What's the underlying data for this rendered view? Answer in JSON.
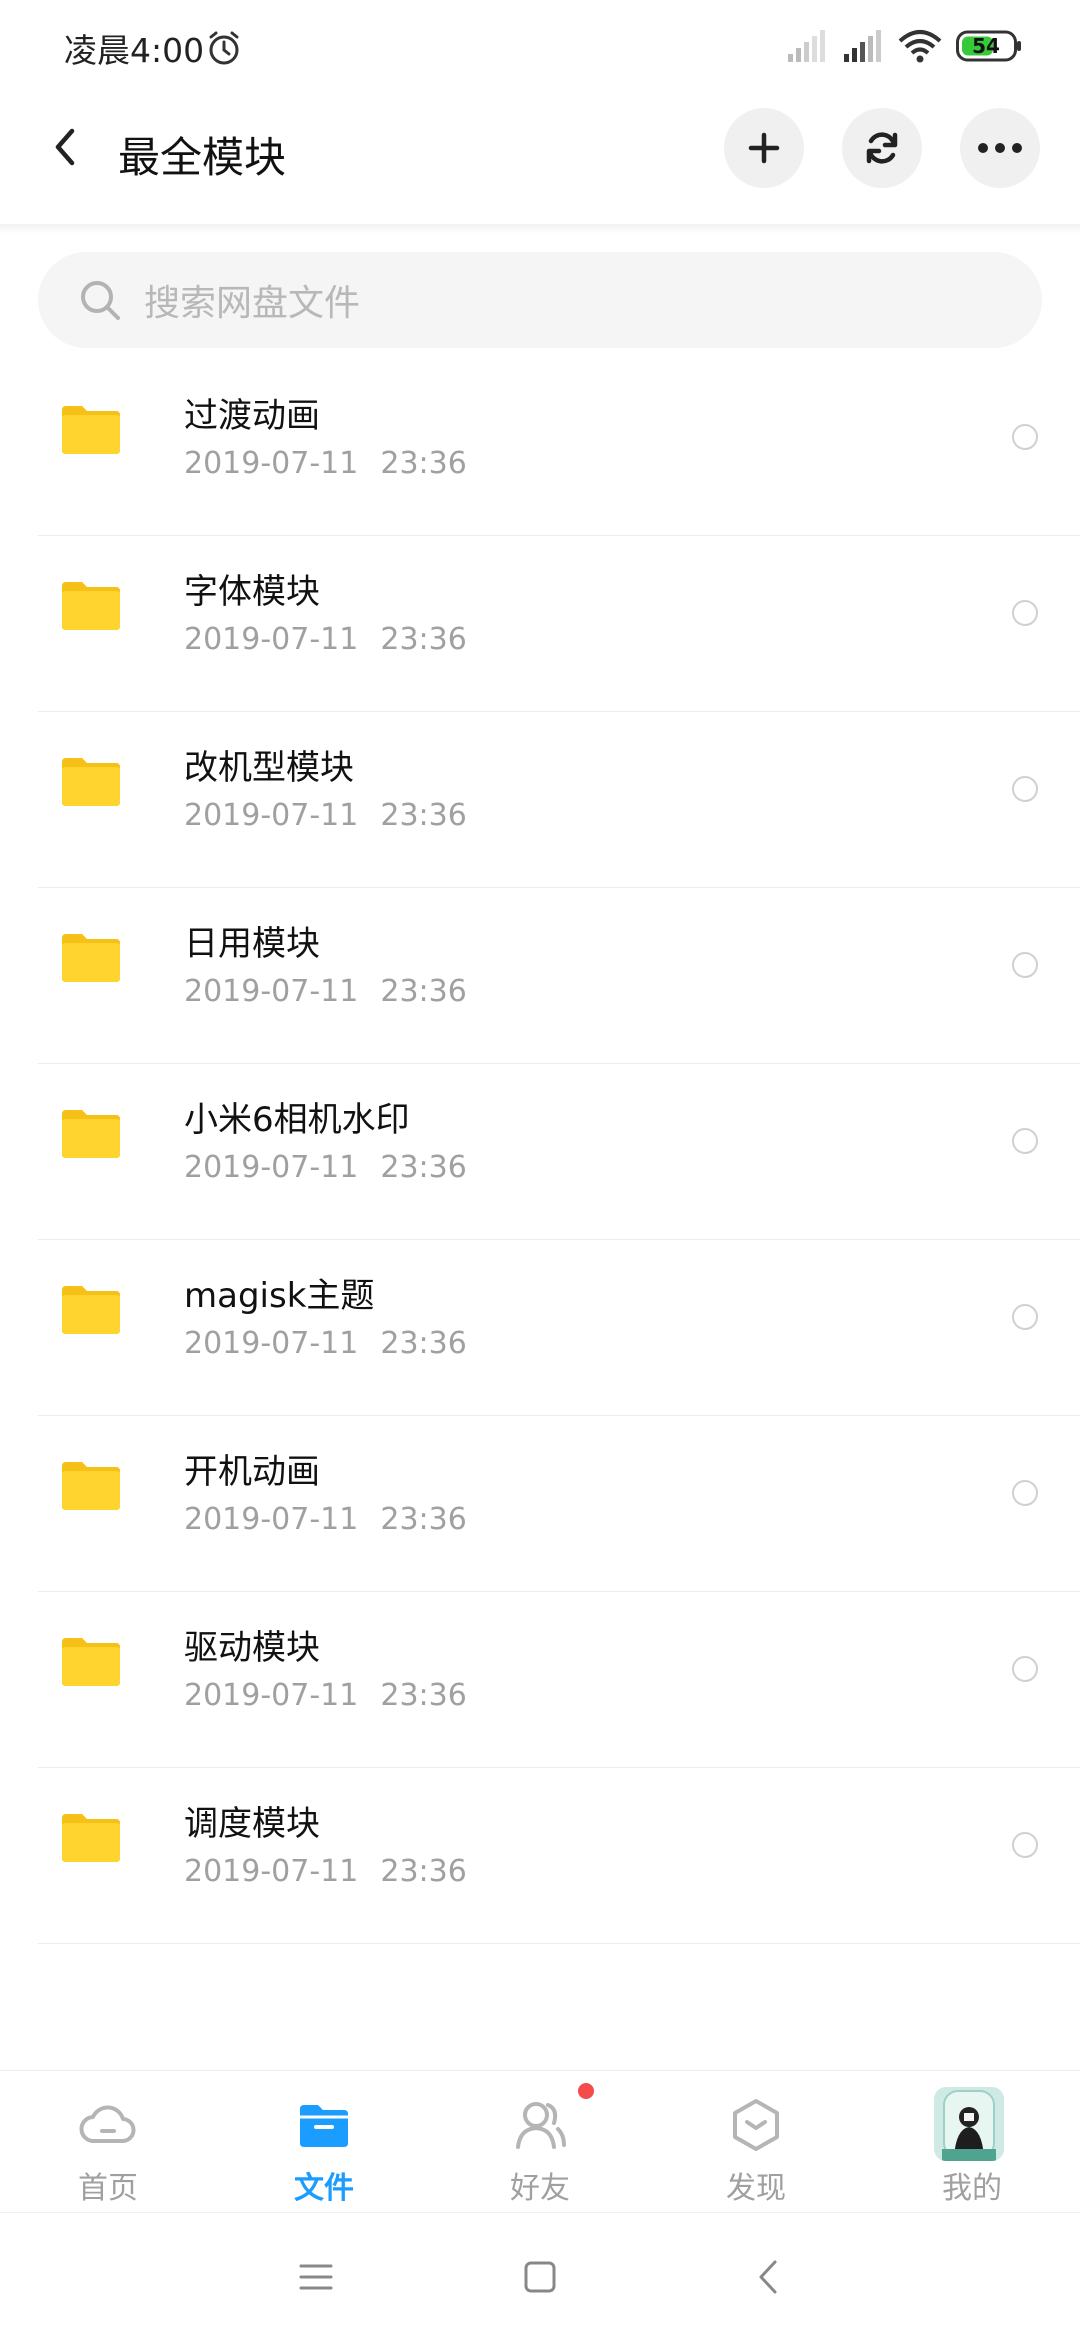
{
  "status_bar": {
    "time": "凌晨4:00",
    "battery": "54"
  },
  "header": {
    "title": "最全模块"
  },
  "search": {
    "placeholder": "搜索网盘文件"
  },
  "files": [
    {
      "name": "过渡动画",
      "date": "2019-07-11",
      "time": "23:36"
    },
    {
      "name": "字体模块",
      "date": "2019-07-11",
      "time": "23:36"
    },
    {
      "name": "改机型模块",
      "date": "2019-07-11",
      "time": "23:36"
    },
    {
      "name": "日用模块",
      "date": "2019-07-11",
      "time": "23:36"
    },
    {
      "name": "小米6相机水印",
      "date": "2019-07-11",
      "time": "23:36"
    },
    {
      "name": "magisk主题",
      "date": "2019-07-11",
      "time": "23:36"
    },
    {
      "name": "开机动画",
      "date": "2019-07-11",
      "time": "23:36"
    },
    {
      "name": "驱动模块",
      "date": "2019-07-11",
      "time": "23:36"
    },
    {
      "name": "调度模块",
      "date": "2019-07-11",
      "time": "23:36"
    }
  ],
  "bottom_nav": {
    "items": [
      {
        "label": "首页",
        "icon": "cloud-icon",
        "active": false
      },
      {
        "label": "文件",
        "icon": "folder-icon",
        "active": true
      },
      {
        "label": "好友",
        "icon": "friends-icon",
        "active": false,
        "badge": true
      },
      {
        "label": "发现",
        "icon": "discover-icon",
        "active": false
      },
      {
        "label": "我的",
        "icon": "avatar",
        "active": false
      }
    ]
  },
  "colors": {
    "accent": "#1a9dff",
    "folder": "#ffd42e",
    "badge": "#f44b4b"
  }
}
